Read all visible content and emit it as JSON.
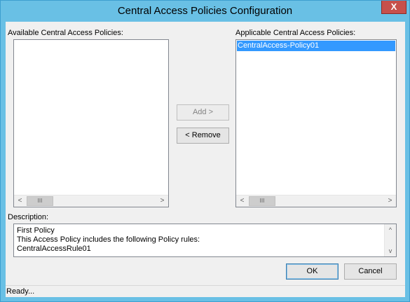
{
  "window": {
    "title": "Central Access Policies Configuration",
    "close_glyph": "X"
  },
  "available": {
    "label": "Available Central Access Policies:",
    "items": []
  },
  "applicable": {
    "label": "Applicable Central Access Policies:",
    "items": [
      {
        "label": "CentralAccess-Policy01",
        "selected": true
      }
    ]
  },
  "transfer": {
    "add_label": "Add >",
    "add_enabled": false,
    "remove_label": "< Remove",
    "remove_enabled": true
  },
  "scrollbar": {
    "left_arrow": "<",
    "right_arrow": ">",
    "thumb_grip": "III",
    "up_arrow": "^",
    "down_arrow": "v"
  },
  "description": {
    "label": "Description:",
    "lines": [
      "First Policy",
      "This Access Policy includes the following Policy rules:",
      "CentralAccessRule01"
    ]
  },
  "dialog_buttons": {
    "ok_label": "OK",
    "cancel_label": "Cancel"
  },
  "status": {
    "text": "Ready..."
  },
  "colors": {
    "frame": "#69c0e5",
    "close_button": "#c7504b",
    "selection": "#3399ff"
  },
  "icons": [
    "close-icon",
    "scroll-left-icon",
    "scroll-right-icon",
    "scroll-up-icon",
    "scroll-down-icon"
  ]
}
